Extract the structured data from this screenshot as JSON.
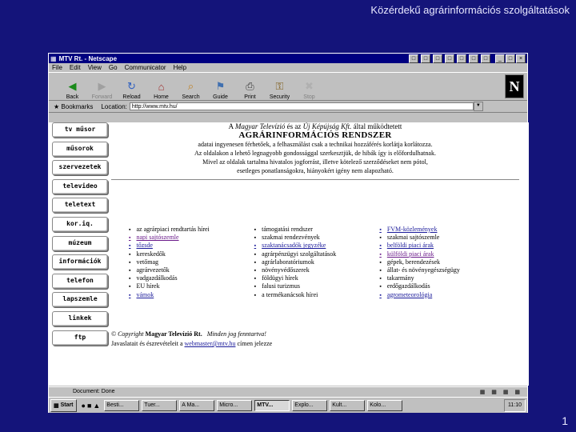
{
  "slide": {
    "title": "Közérdekű agrárinformációs szolgáltatások",
    "page_number": "1"
  },
  "window": {
    "title": "MTV Rt. - Netscape",
    "menu": [
      "File",
      "Edit",
      "View",
      "Go",
      "Communicator",
      "Help"
    ],
    "toolbar": [
      {
        "label": "Back",
        "icon": "back-arrow",
        "disabled": false
      },
      {
        "label": "Forward",
        "icon": "forward-arrow",
        "disabled": true
      },
      {
        "label": "Reload",
        "icon": "reload",
        "disabled": false
      },
      {
        "label": "Home",
        "icon": "home",
        "disabled": false
      },
      {
        "label": "Search",
        "icon": "search",
        "disabled": false
      },
      {
        "label": "Guide",
        "icon": "guide",
        "disabled": false
      },
      {
        "label": "Print",
        "icon": "print",
        "disabled": false
      },
      {
        "label": "Security",
        "icon": "security-lock",
        "disabled": false
      },
      {
        "label": "Stop",
        "icon": "stop",
        "disabled": true
      }
    ],
    "logo": "N",
    "bookmarks_label": "Bookmarks",
    "location_label": "Location:",
    "location_value": "http://www.mtv.hu/"
  },
  "nav": [
    "tv műsor",
    "műsorok",
    "szervezetek",
    "televideo",
    "teletext",
    "kor.iq.",
    "múzeum",
    "információk",
    "telefon",
    "lapszemle",
    "linkek",
    "ftp"
  ],
  "header": {
    "line1_pre": "A ",
    "line1_org1": "Magyar Televízió",
    "line1_mid": " és az ",
    "line1_org2": "Új Képújság Kft.",
    "line1_post": " által működtetett",
    "title": "AGRÁRINFORMÁCIÓS RENDSZER",
    "text1": "adatai ingyenesen férhetőek, a felhasználást csak a technikai hozzáférés korlátja korlátozza.",
    "text2": "Az oldalakon a lehető legnagyobb gondossággal szerkesztjük, de hibák így is előfordulhatnak.",
    "text3": "Mivel az oldalak tartalma hivatalos jogforrást, illetve kötelező szerződéseket nem pótol,",
    "text4": "esetleges ponatlanságokra, hiányokért igény nem alapozható."
  },
  "columns": [
    [
      {
        "text": "az agrárpiaci rendtartás hírei",
        "style": "plain"
      },
      {
        "text": "napi sajtószemle",
        "style": "visited"
      },
      {
        "text": "tőzsde",
        "style": "link"
      },
      {
        "text": "kereskedők",
        "style": "plain"
      },
      {
        "text": "vetőmag",
        "style": "plain"
      },
      {
        "text": "agrárvezetők",
        "style": "plain"
      },
      {
        "text": "vadgazdálkodás",
        "style": "plain"
      },
      {
        "text": "EU hírek",
        "style": "plain"
      },
      {
        "text": "vámok",
        "style": "link"
      }
    ],
    [
      {
        "text": "támogatási rendszer",
        "style": "plain"
      },
      {
        "text": "szakmai rendezvények",
        "style": "plain"
      },
      {
        "text": "szaktanácsadók jegyzéke",
        "style": "link"
      },
      {
        "text": "agrárpénzügyi szolgáltatások",
        "style": "plain"
      },
      {
        "text": "agrárlaboratóriumok",
        "style": "plain"
      },
      {
        "text": "növényvédőszerek",
        "style": "plain"
      },
      {
        "text": "földügyi hírek",
        "style": "plain"
      },
      {
        "text": "falusi turizmus",
        "style": "plain"
      },
      {
        "text": "a termékanácsok hírei",
        "style": "plain"
      }
    ],
    [
      {
        "text": "FVM-közlemények",
        "style": "link"
      },
      {
        "text": "szakmai sajtószemle",
        "style": "plain"
      },
      {
        "text": "belföldi piaci árak",
        "style": "link"
      },
      {
        "text": "külföldi piaci árak",
        "style": "visited"
      },
      {
        "text": "gépek, berendezések",
        "style": "plain"
      },
      {
        "text": "állat- és növényegészségügy",
        "style": "plain"
      },
      {
        "text": "takarmány",
        "style": "plain"
      },
      {
        "text": "erdőgazdálkodás",
        "style": "plain"
      },
      {
        "text": "agrometeorológia",
        "style": "link"
      }
    ]
  ],
  "footer": {
    "copyright_label": "© Copyright",
    "copyright_org": "Magyar Televízió Rt.",
    "copyright_rights": "Minden jog fenntartva!",
    "contact_pre": "Javaslatait és észrevételeit a ",
    "contact_email": "webmaster@mtv.hu",
    "contact_post": " címen jelezze"
  },
  "status": "Document: Done",
  "taskbar": {
    "start": "Start",
    "tasks": [
      "Besti...",
      "Tuer...",
      "A Ma...",
      "Micro...",
      "MTV...",
      "Explo...",
      "Kult...",
      "Kolo..."
    ],
    "active_index": 4,
    "clock": "11:10"
  }
}
